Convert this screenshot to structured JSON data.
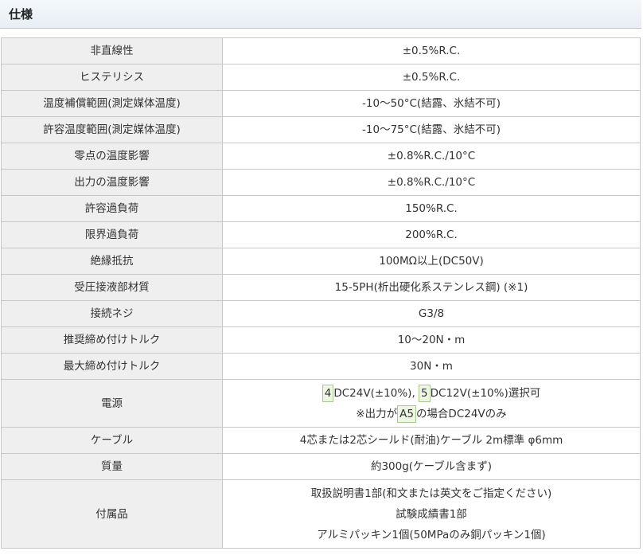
{
  "section": {
    "title": "仕様"
  },
  "rows": [
    {
      "label": "非直線性",
      "value": "±0.5%R.C."
    },
    {
      "label": "ヒステリシス",
      "value": "±0.5%R.C."
    },
    {
      "label": "温度補償範囲(測定媒体温度)",
      "value": "-10〜50°C(結露、氷結不可)"
    },
    {
      "label": "許容温度範囲(測定媒体温度)",
      "value": "-10〜75°C(結露、氷結不可)"
    },
    {
      "label": "零点の温度影響",
      "value": "±0.8%R.C./10°C"
    },
    {
      "label": "出力の温度影響",
      "value": "±0.8%R.C./10°C"
    },
    {
      "label": "許容過負荷",
      "value": "150%R.C."
    },
    {
      "label": "限界過負荷",
      "value": "200%R.C."
    },
    {
      "label": "絶縁抵抗",
      "value": "100MΩ以上(DC50V)"
    },
    {
      "label": "受圧接液部材質",
      "value": "15-5PH(析出硬化系ステンレス鋼) (※1)"
    },
    {
      "label": "接続ネジ",
      "value": "G3/8"
    },
    {
      "label": "推奨締め付けトルク",
      "value": "10〜20N・m"
    },
    {
      "label": "最大締め付けトルク",
      "value": "30N・m"
    }
  ],
  "power": {
    "label": "電源",
    "code1": "4",
    "text1": "DC24V(±10%),",
    "code2": "5",
    "text2": "DC12V(±10%)選択可",
    "note_pre": "※出力が",
    "note_code": "A5",
    "note_post": "の場合DC24Vのみ"
  },
  "cable": {
    "label": "ケーブル",
    "value": "4芯または2芯シールド(耐油)ケーブル 2m標準 φ6mm"
  },
  "mass": {
    "label": "質量",
    "value": "約300g(ケーブル含まず)"
  },
  "accessories": {
    "label": "付属品",
    "items": [
      "取扱説明書1部(和文または英文をご指定ください)",
      "試験成績書1部",
      "アルミパッキン1個(50MPaのみ銅パッキン1個)"
    ]
  }
}
